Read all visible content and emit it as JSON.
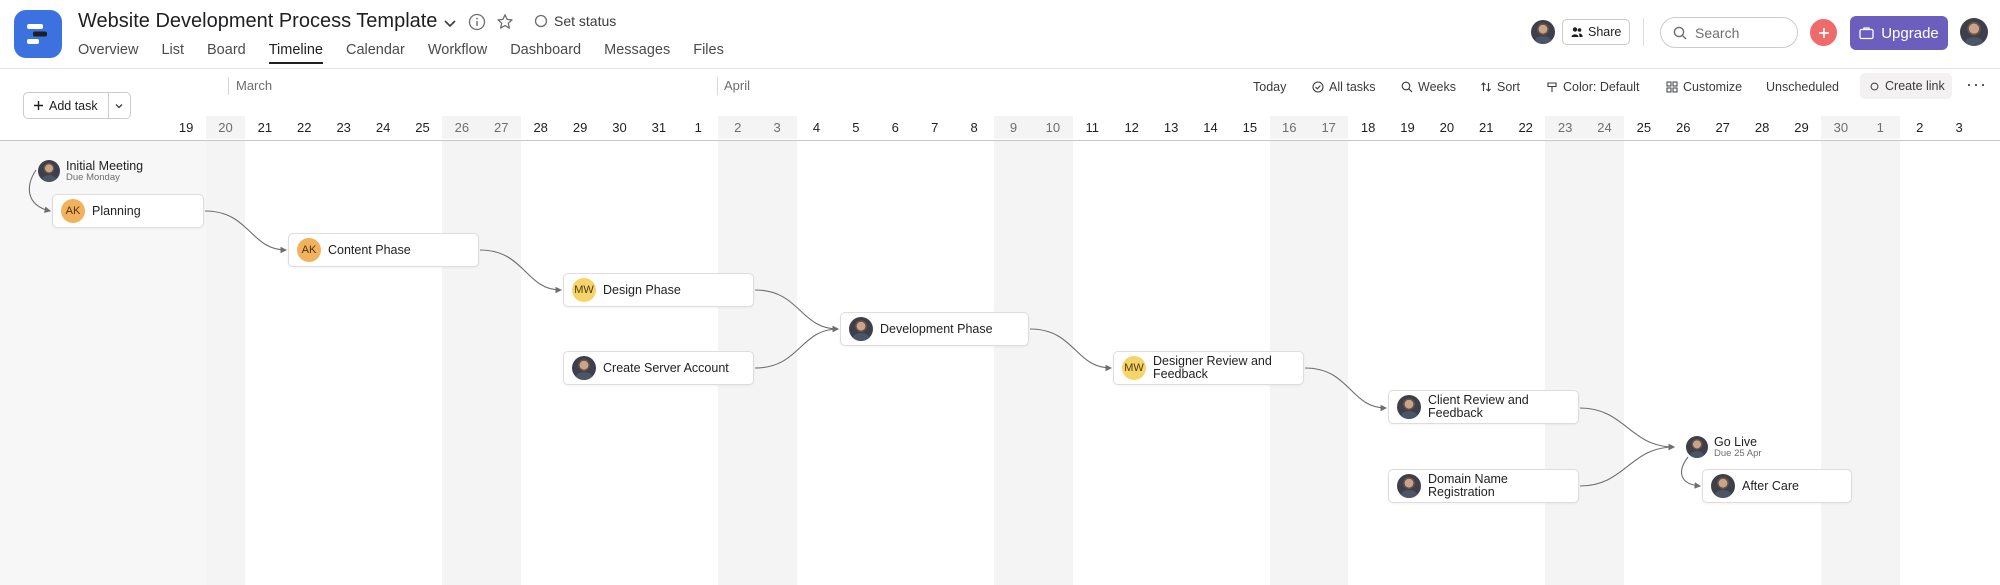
{
  "project": {
    "title": "Website Development Process Template",
    "set_status": "Set status"
  },
  "tabs": [
    "Overview",
    "List",
    "Board",
    "Timeline",
    "Calendar",
    "Workflow",
    "Dashboard",
    "Messages",
    "Files"
  ],
  "active_tab": "Timeline",
  "header": {
    "share_label": "Share",
    "search_placeholder": "Search",
    "upgrade_label": "Upgrade",
    "accent_color": "#6b5ebd",
    "add_color": "#f06a6a"
  },
  "toolbar": {
    "add_task": "Add task",
    "today": "Today",
    "all_tasks": "All tasks",
    "weeks": "Weeks",
    "sort": "Sort",
    "color": "Color: Default",
    "customize": "Customize",
    "unscheduled": "Unscheduled",
    "create_link": "Create link"
  },
  "timeline": {
    "months": [
      "March",
      "April"
    ],
    "days": [
      "19",
      "20",
      "21",
      "22",
      "23",
      "24",
      "25",
      "26",
      "27",
      "28",
      "29",
      "30",
      "31",
      "1",
      "2",
      "3",
      "4",
      "5",
      "6",
      "7",
      "8",
      "9",
      "10",
      "11",
      "12",
      "13",
      "14",
      "15",
      "16",
      "17",
      "18",
      "19",
      "20",
      "21",
      "22",
      "23",
      "24",
      "25",
      "26",
      "27",
      "28",
      "29",
      "30",
      "1",
      "2",
      "3"
    ],
    "weekend_days": [
      "20",
      "26",
      "27",
      "2",
      "3",
      "9",
      "10",
      "16",
      "17",
      "23",
      "24",
      "30",
      "1"
    ],
    "tasks": [
      {
        "name": "Initial Meeting",
        "due": "Due Monday",
        "type": "milestone",
        "assignee": "photo"
      },
      {
        "name": "Planning",
        "type": "task",
        "assignee": "AK"
      },
      {
        "name": "Content Phase",
        "type": "task",
        "assignee": "AK"
      },
      {
        "name": "Design Phase",
        "type": "task",
        "assignee": "MW"
      },
      {
        "name": "Create Server Account",
        "type": "task",
        "assignee": "photo"
      },
      {
        "name": "Development Phase",
        "type": "task",
        "assignee": "photo"
      },
      {
        "name": "Designer Review and Feedback",
        "type": "task",
        "assignee": "MW"
      },
      {
        "name": "Client Review and Feedback",
        "type": "task",
        "assignee": "photo"
      },
      {
        "name": "Domain Name Registration",
        "type": "task",
        "assignee": "photo"
      },
      {
        "name": "Go Live",
        "due": "Due 25 Apr",
        "type": "milestone",
        "assignee": "photo"
      },
      {
        "name": "After Care",
        "type": "task",
        "assignee": "photo"
      }
    ]
  }
}
